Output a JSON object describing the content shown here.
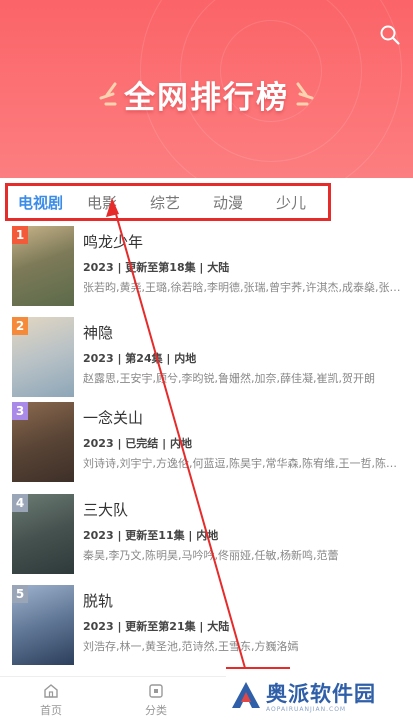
{
  "header": {
    "title": "全网排行榜",
    "bg_color": "#fb6468"
  },
  "tabs": [
    {
      "label": "电视剧",
      "active": true
    },
    {
      "label": "电影",
      "active": false
    },
    {
      "label": "综艺",
      "active": false
    },
    {
      "label": "动漫",
      "active": false
    },
    {
      "label": "少儿",
      "active": false
    }
  ],
  "items": [
    {
      "rank": "1",
      "name": "鸣龙少年",
      "meta": "2023 | 更新至第18集 | 大陆",
      "cast": "张若昀,黄尧,王璐,徐若晗,李明德,张瑞,曾宇荞,许淇杰,成泰燊,张艺...",
      "rank_color": "#f25a3a",
      "poster_colors": [
        "#5b6a4a",
        "#c9b48a"
      ]
    },
    {
      "rank": "2",
      "name": "神隐",
      "meta": "2023 | 第24集 | 内地",
      "cast": "赵露思,王安宇,顾兮,李昀锐,鲁姗然,加奈,薛佳凝,崔凯,贺开朗",
      "rank_color": "#f58a3a",
      "poster_colors": [
        "#8da6b8",
        "#e3d7c2"
      ]
    },
    {
      "rank": "3",
      "name": "一念关山",
      "meta": "2023 | 已完结 | 内地",
      "cast": "刘诗诗,刘宇宁,方逸伦,何蓝逗,陈昊宇,常华森,陈宥维,王一哲,陈都...",
      "rank_color": "#a98ae8",
      "poster_colors": [
        "#3d2f28",
        "#8c6a4f"
      ]
    },
    {
      "rank": "4",
      "name": "三大队",
      "meta": "2023 | 更新至11集 | 内地",
      "cast": "秦昊,李乃文,陈明昊,马吟吟,佟丽娅,任敏,杨新鸣,范蕾",
      "rank_color": "#9aa6b8",
      "poster_colors": [
        "#2e3a3a",
        "#6c7c74"
      ]
    },
    {
      "rank": "5",
      "name": "脱轨",
      "meta": "2023 | 更新至第21集 | 大陆",
      "cast": "刘浩存,林一,黄圣池,范诗然,王雪东,方巍洛嫣",
      "rank_color": "#9aa6b8",
      "poster_colors": [
        "#2c3f5c",
        "#9fb3cf"
      ]
    }
  ],
  "bottom_nav": [
    {
      "label": "首页",
      "icon": "home-icon"
    },
    {
      "label": "分类",
      "icon": "category-icon"
    }
  ],
  "watermark": {
    "name": "奥派软件园",
    "url": "AOPAIRUANJIAN.COM"
  }
}
